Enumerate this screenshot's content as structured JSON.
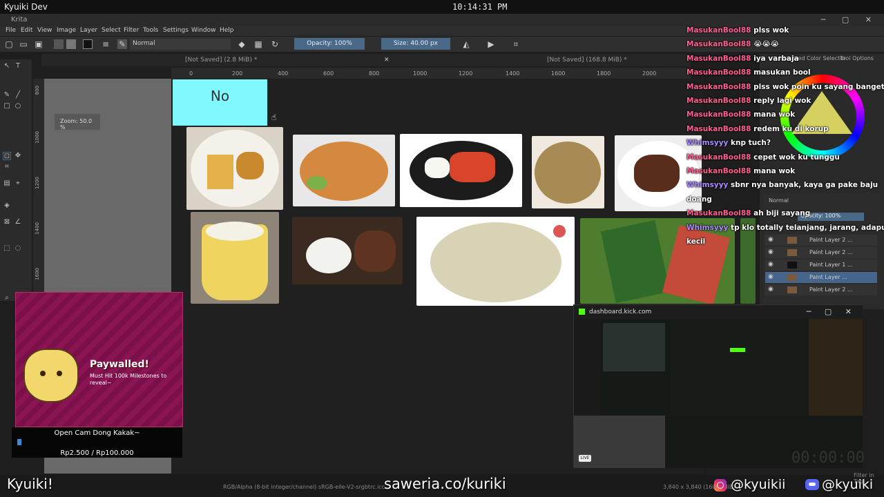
{
  "system": {
    "window_title": "Kyuiki Dev",
    "clock": "10:14:31 PM"
  },
  "app": {
    "title": "Krita"
  },
  "menu": [
    "File",
    "Edit",
    "View",
    "Image",
    "Layer",
    "Select",
    "Filter",
    "Tools",
    "Settings",
    "Window",
    "Help"
  ],
  "toolbar": {
    "blend_mode": "Normal",
    "opacity": "Opacity: 100%",
    "size": "Size: 40.00 px"
  },
  "tabs": [
    {
      "label": "[Not Saved]  (2.8 MiB) *"
    },
    {
      "label": "[Not Saved]  (168.8 MiB) *"
    }
  ],
  "ruler_top": [
    "0",
    "200",
    "400",
    "600",
    "800",
    "1000",
    "1200",
    "1400",
    "1600",
    "1800",
    "2000"
  ],
  "ruler_left": [
    "800",
    "1000",
    "1200",
    "1400",
    "1600"
  ],
  "canvas": {
    "zoom_label": "Zoom: 50.0 %",
    "no_label": "No"
  },
  "chat": [
    {
      "user": "MasukanBool88",
      "msg": "plss wok",
      "kind": "u"
    },
    {
      "user": "MasukanBool88",
      "msg": "😭😭😭",
      "kind": "u"
    },
    {
      "user": "MasukanBool88",
      "msg": "iya varbaja",
      "kind": "u"
    },
    {
      "user": "MasukanBool88",
      "msg": "masukan bool",
      "kind": "u"
    },
    {
      "user": "MasukanBool88",
      "msg": "plss wok poin ku sayang banget",
      "kind": "u"
    },
    {
      "user": "MasukanBool88",
      "msg": "reply lagi wok",
      "kind": "u"
    },
    {
      "user": "MasukanBool88",
      "msg": "mana wok",
      "kind": "u"
    },
    {
      "user": "MasukanBool88",
      "msg": "redem ku di korup",
      "kind": "u"
    },
    {
      "user": "Whimsyyy",
      "msg": "knp tuch?",
      "kind": "u2"
    },
    {
      "user": "MasukanBool88",
      "msg": "cepet wok ku tunggu",
      "kind": "u"
    },
    {
      "user": "MasukanBool88",
      "msg": "mana wok",
      "kind": "u"
    },
    {
      "user": "Whimsyyy",
      "msg": "sbnr nya banyak, kaya ga pake baju",
      "kind": "u2"
    },
    {
      "user": "",
      "msg": "doang",
      "kind": "c"
    },
    {
      "user": "MasukanBool88",
      "msg": "ah biji sayang",
      "kind": "u"
    },
    {
      "user": "Whimsyyy",
      "msg": "tp klo totally telanjang, jarang, adapun",
      "kind": "u2"
    },
    {
      "user": "",
      "msg": "kecil",
      "kind": "c"
    }
  ],
  "dock": {
    "tab1": "Advanced Color Selector",
    "tab2": "Tool Options",
    "blend": "Normal",
    "opacity": "Opacity: 100%"
  },
  "layers": [
    {
      "name": "Paint Layer 2 ...",
      "selected": false
    },
    {
      "name": "Paint Layer 2 ...",
      "selected": false
    },
    {
      "name": "Paint Layer 1 ...",
      "selected": false
    },
    {
      "name": "Paint Layer ...",
      "selected": true
    },
    {
      "name": "Paint Layer 2 ...",
      "selected": false
    }
  ],
  "overlay": {
    "paywall_title": "Paywalled!",
    "paywall_sub": "Must Hit 100k Milestones to reveal~",
    "donation_title": "Open Cam Dong Kakak~",
    "donation_progress": "Rp2.500 / Rp100.000",
    "donation_fraction": 0.025
  },
  "kick": {
    "url": "dashboard.kick.com",
    "live": "LIVE",
    "timer": "00:00:00"
  },
  "status": {
    "color_info": "RGB/Alpha (8-bit integer/channel)  sRGB-elle-V2-srgbtrc.icc",
    "dims": "3,840 x 3,840 (168.8 MiB)",
    "filter": "Filter in Tag"
  },
  "branding": {
    "name": "Kyuiki!",
    "saweria": "saweria.co/kuriki",
    "instagram": "@kyuikii",
    "discord": "@kyuiki"
  },
  "colors": {
    "accent": "#4a6888",
    "no_box": "#80f8ff",
    "chat_user": "#ff5f8f",
    "chat_user2": "#a98bff",
    "kick_green": "#53fc18"
  }
}
